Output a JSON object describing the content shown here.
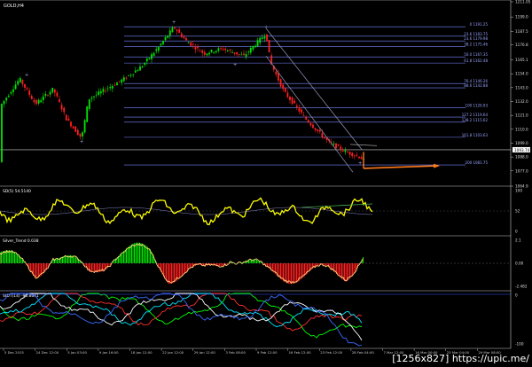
{
  "window": {
    "symbol_label": "GOLD,H4"
  },
  "fib_levels": [
    {
      "label": "0 1191.25",
      "y_value": 1191.25
    },
    {
      "label": "23.6 1183.75",
      "y_value": 1183.75
    },
    {
      "label": "23.6 1179.98",
      "y_value": 1179.98
    },
    {
      "label": "38.2 1175.46",
      "y_value": 1175.46
    },
    {
      "label": "50.0 1167.35",
      "y_value": 1167.35
    },
    {
      "label": "61.8 1162.48",
      "y_value": 1162.48
    },
    {
      "label": "76.4 1146.26",
      "y_value": 1146.26
    },
    {
      "label": "88.6 1142.88",
      "y_value": 1142.88
    },
    {
      "label": "100 1126.93",
      "y_value": 1126.93
    },
    {
      "label": "127.2 1119.64",
      "y_value": 1119.64
    },
    {
      "label": "138.2 1115.62",
      "y_value": 1115.62
    },
    {
      "label": "161.8 1103.63",
      "y_value": 1103.63
    },
    {
      "label": "200 1081.75",
      "y_value": 1081.75
    }
  ],
  "price_axis": {
    "ticks": [
      "1211.05",
      "1199.0",
      "1187.5",
      "1176.8",
      "1165.1",
      "1154.0",
      "1143.0",
      "1132.0",
      "1121.0",
      "1110.0",
      "1099.0",
      "1088.0",
      "1077.0",
      "1064.9"
    ],
    "current_price": "1093.74"
  },
  "panels": [
    {
      "label": "SD(5) 54.5140",
      "scale": [
        "100",
        "52",
        "0"
      ]
    },
    {
      "label": "Silver_Trend 0.038",
      "scale": [
        "2.1",
        "0.00",
        "-2.482"
      ]
    },
    {
      "label": "StDT(14) -90.8841",
      "scale": [
        "0",
        "-100"
      ]
    }
  ],
  "time_axis": [
    "5 Dec 2015",
    "24 Dec 12:00",
    "5 Jan 03:00",
    "9 Jan 16:00",
    "18 Jan 12:00",
    "22 Jan 12:00",
    "29 Jan 12:00",
    "3 Feb 08:00",
    "9 Feb 12:00",
    "16 Feb 12:00",
    "23 Feb 12:00",
    "28 Feb 04:00",
    "7 Mar 12:00",
    "16 Mar 00:00",
    "23 Mar 04:00",
    "29 Mar 08:00"
  ],
  "watermark": "[1256x827] https://upic.me/",
  "colors": {
    "bull": "#00e400",
    "bear": "#ff2020",
    "fib": "#7a86ff",
    "arrow": "#ff7a1a",
    "channel": "#8888aa",
    "osc_yellow": "#ffff00"
  }
}
